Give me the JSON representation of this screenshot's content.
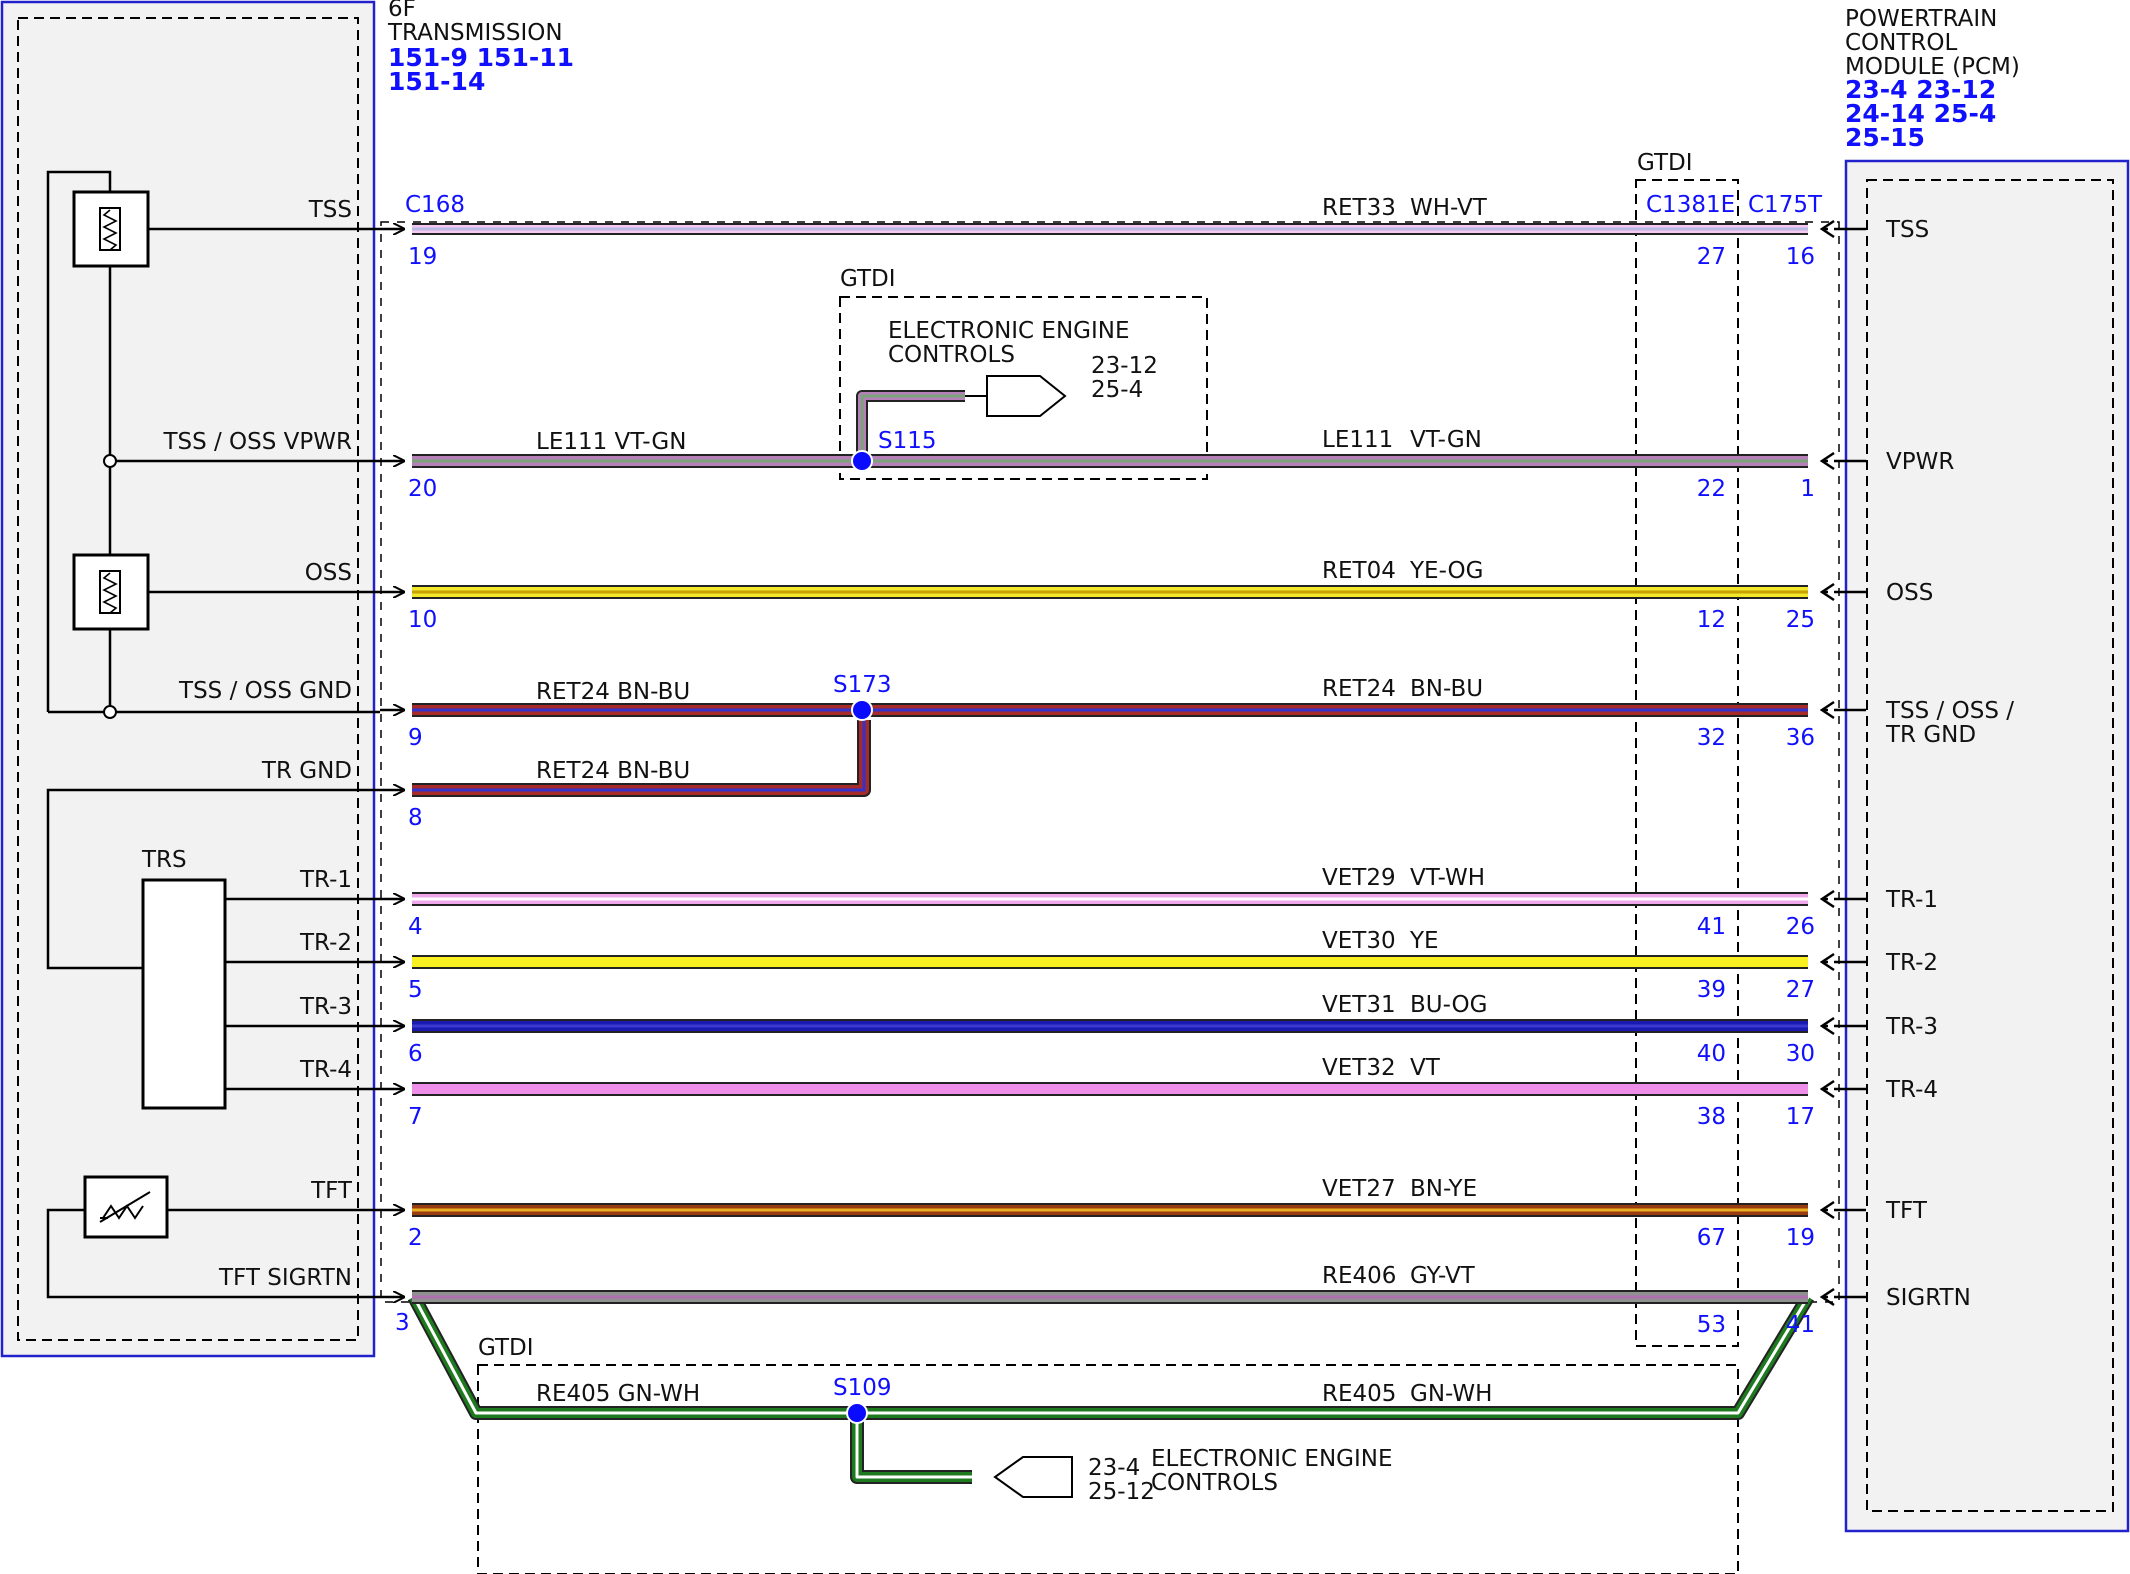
{
  "module_left": {
    "title": [
      "6F",
      "TRANSMISSION"
    ],
    "refs": [
      "151-9  151-11",
      "151-14"
    ],
    "trs_label": "TRS"
  },
  "module_right": {
    "title": [
      "POWERTRAIN",
      "CONTROL",
      "MODULE (PCM)"
    ],
    "refs": [
      "23-4  23-12",
      "24-14 25-4",
      "25-15"
    ]
  },
  "connectors": {
    "left": "C168",
    "mid": "C1381E",
    "right": "C175T"
  },
  "gtdi_label": "GTDI",
  "circuits": [
    {
      "id": "tss",
      "left_label": "TSS",
      "right_label": [
        "TSS"
      ],
      "circuit": "RET33",
      "color_code": "WH-VT",
      "c1": "19",
      "c2": "27",
      "c3": "16",
      "colors": [
        "#f4c8f0",
        "#b9b9e6"
      ]
    },
    {
      "id": "vpwr",
      "left_label": "TSS / OSS VPWR",
      "right_label": [
        "VPWR"
      ],
      "circuit": "LE111",
      "color_code": "VT-GN",
      "c1": "20",
      "c2": "22",
      "c3": "1",
      "colors": [
        "#b580b8",
        "#7aa37a"
      ]
    },
    {
      "id": "oss",
      "left_label": "OSS",
      "right_label": [
        "OSS"
      ],
      "circuit": "RET04",
      "color_code": "YE-OG",
      "c1": "10",
      "c2": "12",
      "c3": "25",
      "colors": [
        "#f1e82a",
        "#c8a000"
      ]
    },
    {
      "id": "gnd",
      "left_label": "TSS / OSS GND",
      "right_label": [
        "TSS / OSS /",
        "TR GND"
      ],
      "circuit": "RET24",
      "color_code": "BN-BU",
      "c1": "9",
      "c2": "32",
      "c3": "36",
      "colors": [
        "#a52a2a",
        "#3333cc"
      ]
    },
    {
      "id": "trgnd",
      "left_label": "TR GND",
      "right_label": [],
      "circuit": "RET24",
      "color_code": "BN-BU",
      "c1": "8",
      "c2": "",
      "c3": "",
      "colors": [
        "#a52a2a",
        "#3333cc"
      ]
    },
    {
      "id": "tr1",
      "left_label": "TR-1",
      "right_label": [
        "TR-1"
      ],
      "circuit": "VET29",
      "color_code": "VT-WH",
      "c1": "4",
      "c2": "41",
      "c3": "26",
      "colors": [
        "#f0a8ec",
        "#ffffff"
      ]
    },
    {
      "id": "tr2",
      "left_label": "TR-2",
      "right_label": [
        "TR-2"
      ],
      "circuit": "VET30",
      "color_code": "YE",
      "c1": "5",
      "c2": "39",
      "c3": "27",
      "colors": [
        "#f8f020",
        "#f8f020"
      ]
    },
    {
      "id": "tr3",
      "left_label": "TR-3",
      "right_label": [
        "TR-3"
      ],
      "circuit": "VET31",
      "color_code": "BU-OG",
      "c1": "6",
      "c2": "40",
      "c3": "30",
      "colors": [
        "#1a1ab0",
        "#3a3ad0"
      ]
    },
    {
      "id": "tr4",
      "left_label": "TR-4",
      "right_label": [
        "TR-4"
      ],
      "circuit": "VET32",
      "color_code": "VT",
      "c1": "7",
      "c2": "38",
      "c3": "17",
      "colors": [
        "#ee8ee8",
        "#ee8ee8"
      ]
    },
    {
      "id": "tft",
      "left_label": "TFT",
      "right_label": [
        "TFT"
      ],
      "circuit": "VET27",
      "color_code": "BN-YE",
      "c1": "2",
      "c2": "67",
      "c3": "19",
      "colors": [
        "#9a3a10",
        "#e8b020"
      ]
    },
    {
      "id": "sigrtn",
      "left_label": "TFT SIGRTN",
      "right_label": [
        "SIGRTN"
      ],
      "circuit": "RE406",
      "color_code": "GY-VT",
      "c1": "3",
      "c2": "53",
      "c3": "41",
      "colors": [
        "#909090",
        "#b070b0"
      ]
    },
    {
      "id": "re405",
      "left_label": "",
      "right_label": [],
      "circuit": "RE405",
      "color_code": "GN-WH",
      "c1": "",
      "c2": "",
      "c3": "",
      "colors": [
        "#1e7a1e",
        "#ffffff"
      ]
    }
  ],
  "splices": {
    "s115": "S115",
    "s173": "S173",
    "s109": "S109"
  },
  "eec_upper": {
    "title": [
      "ELECTRONIC ENGINE",
      "CONTROLS"
    ],
    "refs": [
      "23-12",
      "25-4"
    ]
  },
  "eec_lower": {
    "title": [
      "ELECTRONIC ENGINE",
      "CONTROLS"
    ],
    "refs": [
      "23-4",
      "25-12"
    ]
  },
  "wire_labels": {
    "vpwr_left": "LE111  VT-GN",
    "gnd_left": "RET24   BN-BU",
    "trgnd_left": "RET24   BN-BU",
    "re405_left": "RE405   GN-WH"
  },
  "colors": {
    "module_border": "#2222cc",
    "splice": "#0a0aff",
    "panel": "#f2f2f2"
  }
}
